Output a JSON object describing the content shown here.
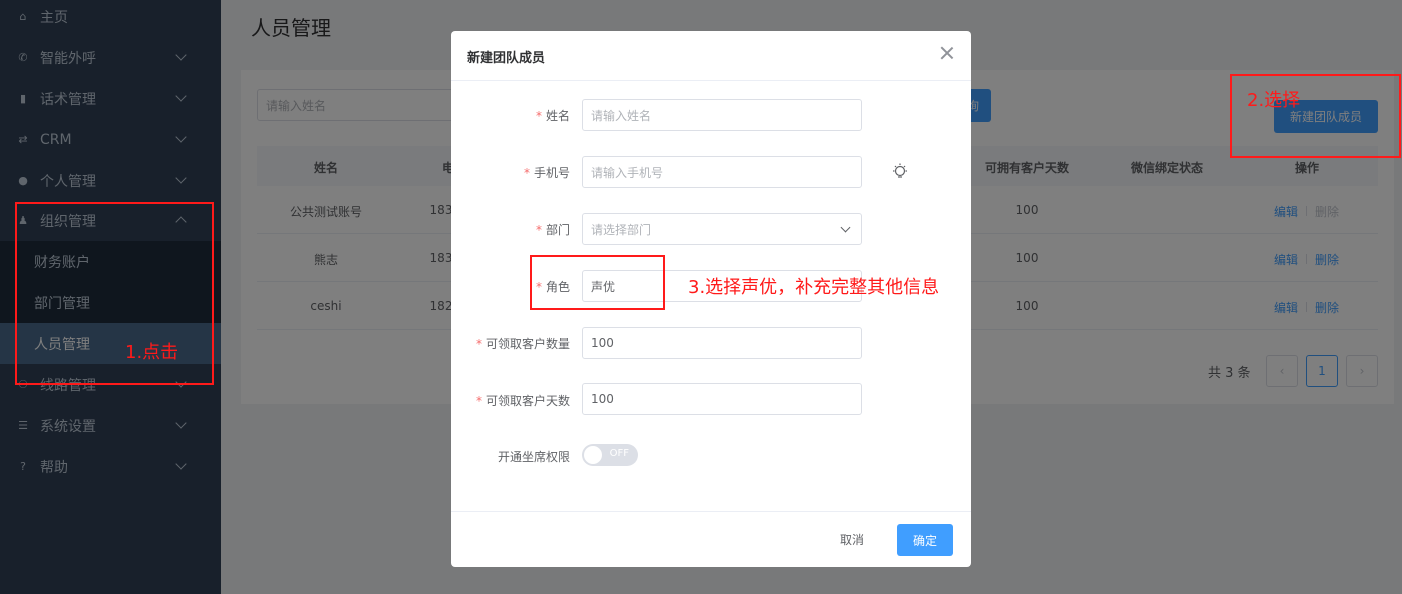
{
  "sidebar": {
    "items": [
      {
        "label": "主页",
        "icon": "home-icon"
      },
      {
        "label": "智能外呼",
        "icon": "phone-icon"
      },
      {
        "label": "话术管理",
        "icon": "book-icon"
      },
      {
        "label": "CRM",
        "icon": "crm-icon"
      },
      {
        "label": "个人管理",
        "icon": "user-icon"
      },
      {
        "label": "组织管理",
        "icon": "org-icon"
      },
      {
        "label": "线路管理",
        "icon": "route-icon"
      },
      {
        "label": "系统设置",
        "icon": "settings-icon"
      },
      {
        "label": "帮助",
        "icon": "help-icon"
      }
    ],
    "submenu": [
      "财务账户",
      "部门管理",
      "人员管理"
    ]
  },
  "page": {
    "title": "人员管理",
    "search_placeholder": "请输入姓名",
    "search_button": "询",
    "new_button": "新建团队成员"
  },
  "table": {
    "headers": [
      "姓名",
      "电",
      "可拥有客户天数",
      "微信绑定状态",
      "操作"
    ],
    "rows": [
      {
        "name": "公共测试账号",
        "phone": "183",
        "days": "100",
        "edit": "编辑",
        "delete": "删除",
        "delete_disabled": true
      },
      {
        "name": "熊志",
        "phone": "183",
        "days": "100",
        "edit": "编辑",
        "delete": "删除",
        "delete_disabled": false
      },
      {
        "name": "ceshi",
        "phone": "182",
        "days": "100",
        "edit": "编辑",
        "delete": "删除",
        "delete_disabled": false
      }
    ]
  },
  "pagination": {
    "total": "共 3 条",
    "current": "1",
    "prev": "‹",
    "next": "›"
  },
  "dialog": {
    "title": "新建团队成员",
    "fields": {
      "name": {
        "label": "姓名",
        "placeholder": "请输入姓名",
        "required": "*"
      },
      "phone": {
        "label": "手机号",
        "placeholder": "请输入手机号",
        "required": "*"
      },
      "dept": {
        "label": "部门",
        "placeholder": "请选择部门",
        "required": "*"
      },
      "role": {
        "label": "角色",
        "value": "声优",
        "required": "*"
      },
      "max_customers": {
        "label": "可领取客户数量",
        "value": "100",
        "required": "*"
      },
      "max_days": {
        "label": "可领取客户天数",
        "value": "100",
        "required": "*"
      },
      "seat": {
        "label": "开通坐席权限",
        "switch_text": "OFF"
      }
    },
    "cancel": "取消",
    "confirm": "确定"
  },
  "annotations": {
    "step1": "1.点击",
    "step2": "2.选择",
    "step3": "3.选择声优，补充完整其他信息",
    "color": "#ff1a1a"
  },
  "colors": {
    "primary": "#409eff",
    "sidebar_bg": "#304156",
    "danger": "#f56c6c"
  }
}
